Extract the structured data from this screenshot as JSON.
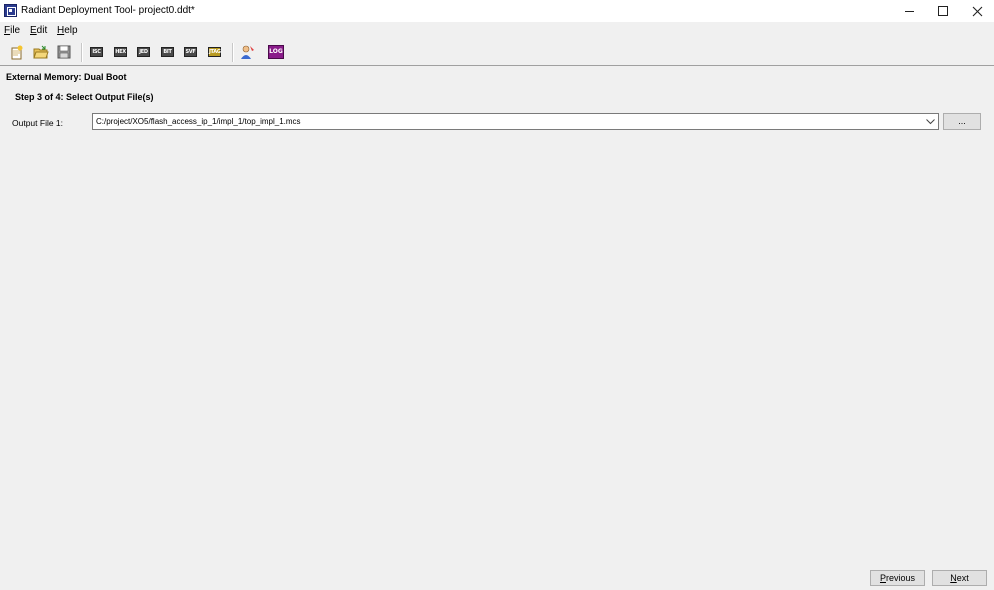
{
  "window": {
    "title": "Radiant Deployment Tool- project0.ddt*"
  },
  "menubar": [
    {
      "accel": "F",
      "rest": "ile"
    },
    {
      "accel": "E",
      "rest": "dit"
    },
    {
      "accel": "H",
      "rest": "elp"
    }
  ],
  "toolbar": {
    "chips": [
      "ISC",
      "HEX",
      "JED",
      "BIT",
      "SVF",
      "JTAG"
    ],
    "log": "LOG"
  },
  "content": {
    "memory_label": "External Memory: Dual Boot",
    "step_label": "Step 3 of 4: Select Output File(s)",
    "output_file_label": "Output File 1:",
    "output_file_value": "C:/project/XO5/flash_access_ip_1/impl_1/top_impl_1.mcs",
    "browse_label": "..."
  },
  "footer": {
    "previous": {
      "accel": "P",
      "rest": "revious"
    },
    "next": {
      "accel": "N",
      "rest": "ext"
    }
  }
}
